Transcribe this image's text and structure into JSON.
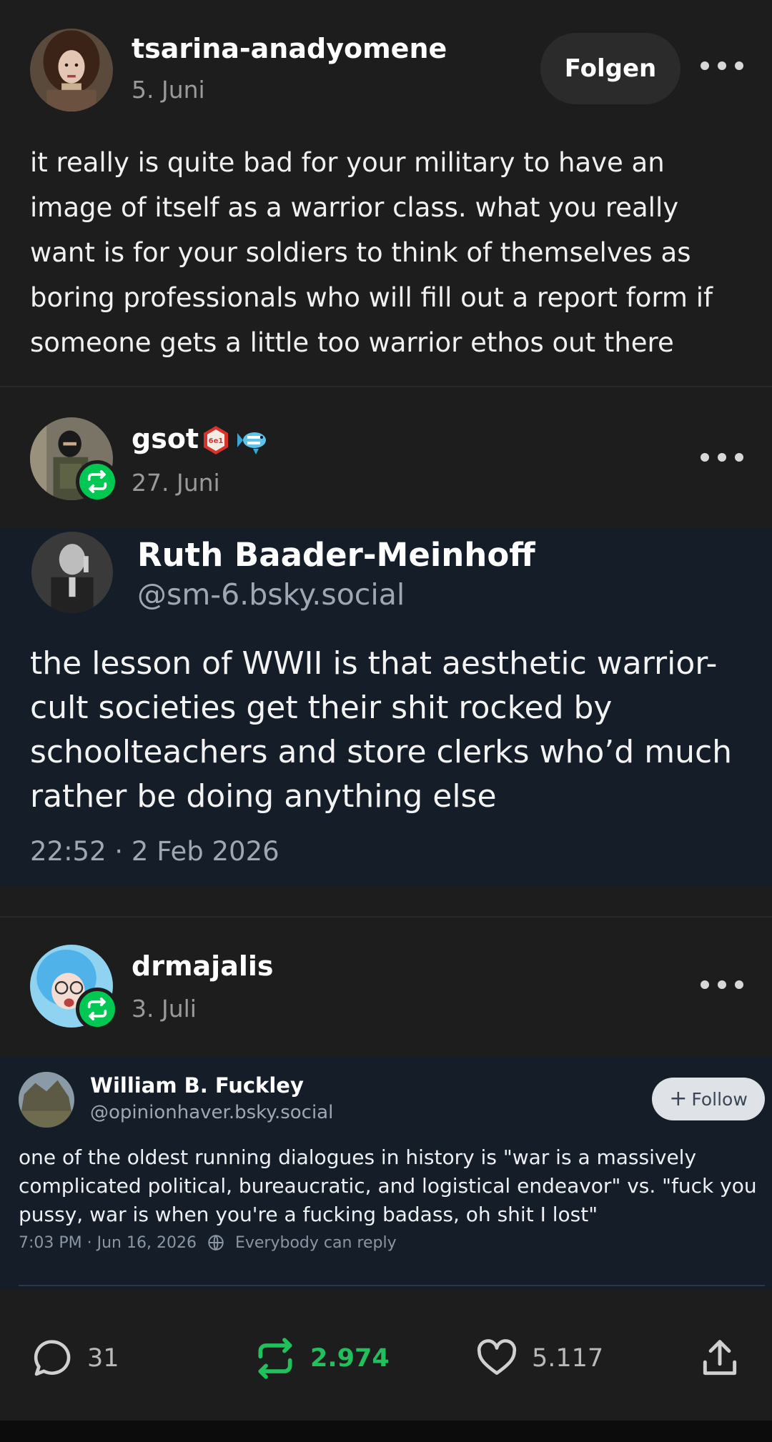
{
  "post": {
    "author": "tsarina-anadyomene",
    "date": "5. Juni",
    "follow_label": "Folgen",
    "body": "it really is quite bad for your military to have an image of itself as a warrior class. what you really want is for your soldiers to think of themselves as boring professionals who will fill out a report form if someone gets a little too warrior ethos out there"
  },
  "reblog_1": {
    "author": "gsot",
    "badge_text": "6e1",
    "date": "27. Juni",
    "embed": {
      "name": "Ruth Baader-Meinhoff",
      "handle": "@sm-6.bsky.social",
      "text": "the lesson of WWII is that aesthetic warrior-cult societies get their shit rocked by schoolteachers and store clerks who’d much rather be doing anything else",
      "timestamp": "22:52 · 2 Feb 2026"
    }
  },
  "reblog_2": {
    "author": "drmajalis",
    "date": "3. Juli",
    "embed": {
      "name": "William B. Fuckley",
      "handle": "@opinionhaver.bsky.social",
      "follow_label": "Follow",
      "text": "one of the oldest running dialogues in history is \"war is a massively complicated political, bureaucratic, and logistical endeavor\" vs. \"fuck you pussy, war is when you're a fucking badass, oh shit I lost\"",
      "timestamp": "7:03 PM · Jun 16, 2026",
      "reply_setting": "Everybody can reply"
    }
  },
  "actions": {
    "comments": "31",
    "reblogs": "2.974",
    "likes": "5.117"
  },
  "colors": {
    "background": "#1d1d1d",
    "embed_background": "#151d28",
    "reblog_green": "#00c853",
    "text_muted": "#9a9a9a"
  },
  "icons": [
    "more-icon",
    "reblog-icon",
    "comment-icon",
    "heart-icon",
    "share-icon",
    "globe-icon",
    "plus-icon",
    "badge-icon",
    "fish-icon"
  ]
}
